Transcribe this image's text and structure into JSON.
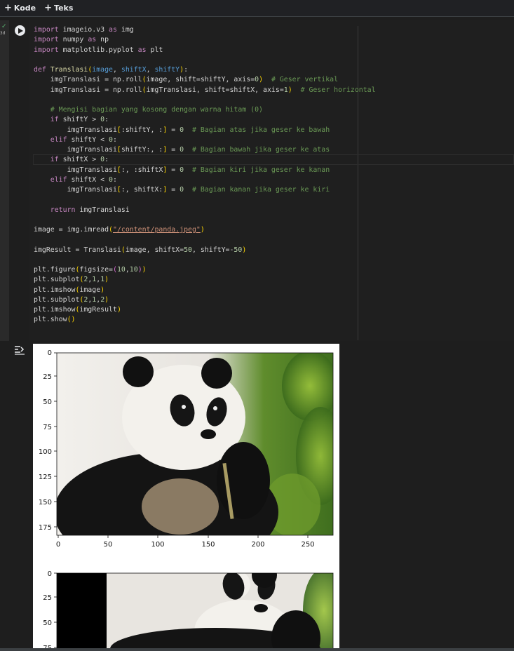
{
  "toolbar": {
    "code_label": "Kode",
    "text_label": "Teks"
  },
  "cell": {
    "exec_time": "3d",
    "code_lines": [
      "import imageio.v3 as img",
      "import numpy as np",
      "import matplotlib.pyplot as plt",
      "",
      "def Translasi(image, shiftX, shiftY):",
      "    imgTranslasi = np.roll(image, shift=shiftY, axis=0)  # Geser vertikal",
      "    imgTranslasi = np.roll(imgTranslasi, shift=shiftX, axis=1)  # Geser horizontal",
      "",
      "    # Mengisi bagian yang kosong dengan warna hitam (0)",
      "    if shiftY > 0:",
      "        imgTranslasi[:shiftY, :] = 0  # Bagian atas jika geser ke bawah",
      "    elif shiftY < 0:",
      "        imgTranslasi[shiftY:, :] = 0  # Bagian bawah jika geser ke atas",
      "    if shiftX > 0:",
      "        imgTranslasi[:, :shiftX] = 0  # Bagian kiri jika geser ke kanan",
      "    elif shiftX < 0:",
      "        imgTranslasi[:, shiftX:] = 0  # Bagian kanan jika geser ke kiri",
      "",
      "    return imgTranslasi",
      "",
      "image = img.imread(\"/content/panda.jpeg\")",
      "",
      "imgResult = Translasi(image, shiftX=50, shiftY=-50)",
      "",
      "plt.figure(figsize=(10,10))",
      "plt.subplot(2,1,1)",
      "plt.imshow(image)",
      "plt.subplot(2,1,2)",
      "plt.imshow(imgResult)",
      "plt.show()"
    ]
  },
  "output": {
    "plot1": {
      "y_ticks": [
        "0",
        "25",
        "50",
        "75",
        "100",
        "125",
        "150",
        "175"
      ],
      "x_ticks": [
        "0",
        "50",
        "100",
        "150",
        "200",
        "250"
      ]
    },
    "plot2": {
      "y_ticks": [
        "0",
        "25",
        "50",
        "75"
      ]
    }
  }
}
